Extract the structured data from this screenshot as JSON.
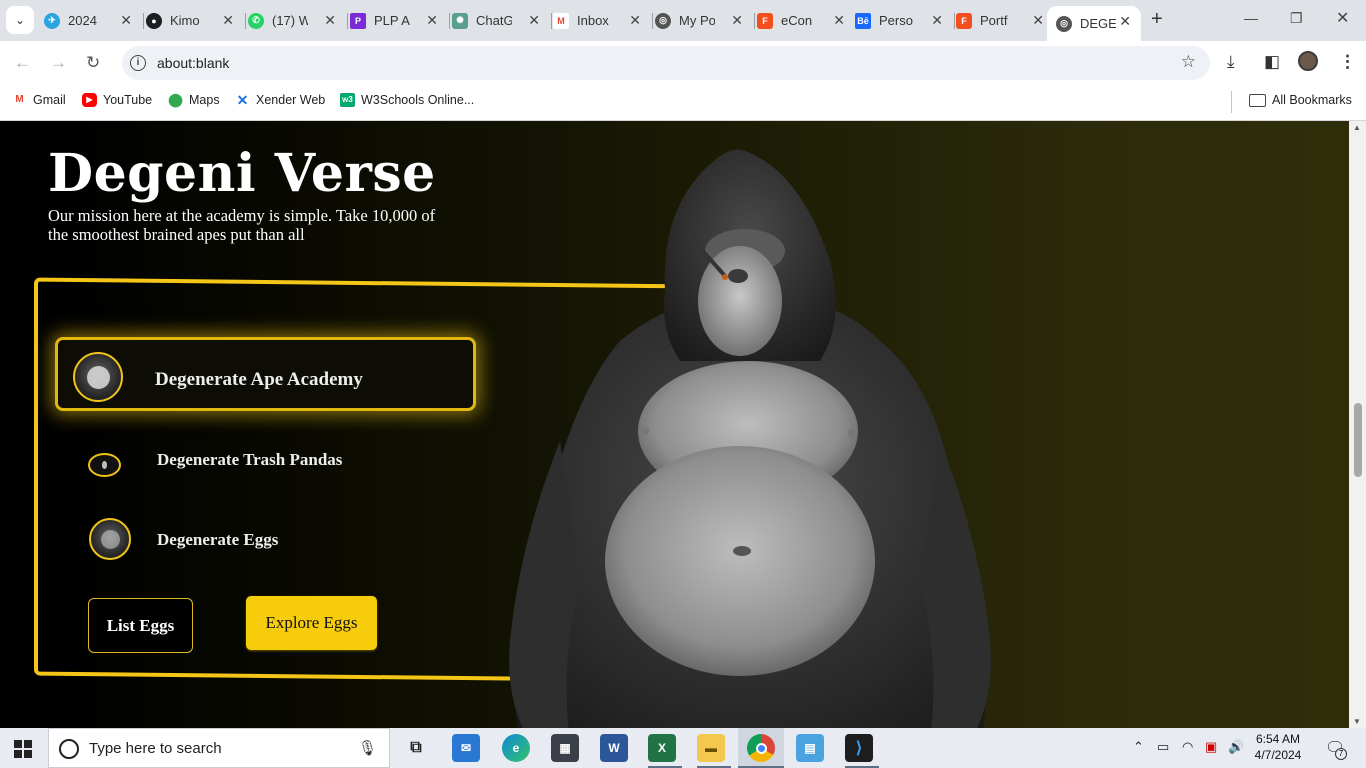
{
  "browser": {
    "tabs": [
      {
        "title": "2024",
        "color": "#2aa3e0",
        "icon": "telegram-icon"
      },
      {
        "title": "Kimo",
        "color": "#1b1f23",
        "icon": "github-icon"
      },
      {
        "title": "(17) W",
        "color": "#25d366",
        "icon": "whatsapp-icon"
      },
      {
        "title": "PLP A",
        "color": "#7a2bd6",
        "icon": "plp-icon"
      },
      {
        "title": "ChatG",
        "color": "#5a9e8f",
        "icon": "chatgpt-icon"
      },
      {
        "title": "Inbox",
        "color": "#ea4335",
        "icon": "gmail-icon"
      },
      {
        "title": "My Po",
        "color": "#555555",
        "icon": "globe-icon"
      },
      {
        "title": "eCon",
        "color": "#f24e1e",
        "icon": "figma-icon"
      },
      {
        "title": "Perso",
        "color": "#1769ff",
        "icon": "behance-icon"
      },
      {
        "title": "Portf",
        "color": "#f24e1e",
        "icon": "figma-icon"
      },
      {
        "title": "DEGE",
        "color": "#555555",
        "icon": "globe-icon",
        "active": true
      }
    ],
    "address": "about:blank",
    "bookmarks": [
      {
        "label": "Gmail",
        "icon": "gmail-icon",
        "color": "#ea4335"
      },
      {
        "label": "YouTube",
        "icon": "youtube-icon",
        "color": "#ff0000"
      },
      {
        "label": "Maps",
        "icon": "maps-icon",
        "color": "#34a853"
      },
      {
        "label": "Xender Web",
        "icon": "xender-icon",
        "color": "#1a73e8"
      },
      {
        "label": "W3Schools Online...",
        "icon": "w3schools-icon",
        "color": "#04aa6d"
      }
    ],
    "all_bookmarks": "All Bookmarks"
  },
  "hero": {
    "title": "Degeni Verse",
    "description": "Our mission here at the academy is simple. Take 10,000 of the smoothest brained apes put than all",
    "items": [
      {
        "label": "Degenerate Ape Academy"
      },
      {
        "label": "Degenerate Trash Pandas"
      },
      {
        "label": "Degenerate Eggs"
      }
    ],
    "buttons": {
      "list": "List Eggs",
      "explore": "Explore Eggs"
    },
    "accent": "#f5c518"
  },
  "taskbar": {
    "search_placeholder": "Type here to search",
    "time": "6:54 AM",
    "date": "4/7/2024",
    "notifications": "7"
  }
}
